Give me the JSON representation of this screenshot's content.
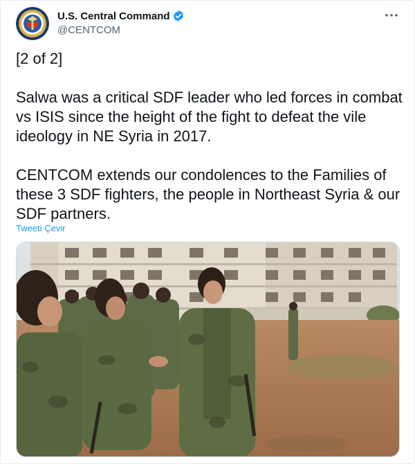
{
  "author": {
    "display_name": "U.S. Central Command",
    "handle": "@CENTCOM",
    "verified": true,
    "avatar_icon": "centcom-seal-icon"
  },
  "menu_icon": "more-horizontal-icon",
  "tweet": {
    "paragraphs": [
      "[2 of 2]",
      "Salwa was a critical SDF leader who led forces in combat vs ISIS since the height of the fight to defeat the vile ideology in NE Syria in 2017.",
      "CENTCOM extends our condolences to the Families of these 3 SDF fighters, the people in Northeast Syria & our SDF partners."
    ],
    "translate_label": "Tweeti Çevir"
  },
  "colors": {
    "link": "#1d9bf0",
    "verified": "#1d9bf0",
    "text": "#0f1419",
    "muted": "#536471"
  }
}
